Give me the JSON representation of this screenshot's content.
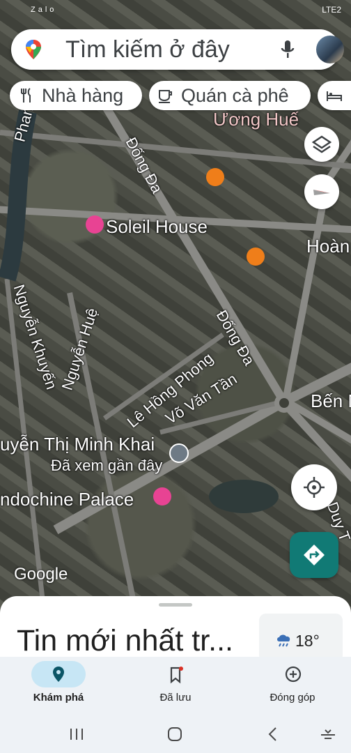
{
  "status_bar": {
    "time": "",
    "left_icons": "Zalo",
    "right_text": "LTE2"
  },
  "search": {
    "placeholder": "Tìm kiếm ở đây"
  },
  "chips": [
    {
      "label": "Nhà hàng",
      "icon": "restaurant-icon"
    },
    {
      "label": "Quán cà phê",
      "icon": "coffee-icon"
    },
    {
      "label": "",
      "icon": "hotel-icon"
    }
  ],
  "map": {
    "place_labels": {
      "soleil": "Soleil House",
      "minh_khai": "uyễn Thị Minh Khai",
      "recent": "Đã xem gần đây",
      "indochine": "ndochine Palace",
      "uong_hue": "Ương Huế",
      "hoan": "Hoàn",
      "ben": "Bến N"
    },
    "street_labels": {
      "dong_da_top": "Đống Đa",
      "dong_da_mid": "Đống Đa",
      "phan": "Phan",
      "nguyen_khuyen": "Nguyễn Khuyến",
      "nguyen_hue": "Nguyễn Huệ",
      "le_hong_phong": "Lê Hồng Phong",
      "vo_van_tan": "Võ Văn Tần",
      "duy": "Duy T"
    },
    "attribution": "Google",
    "colors": {
      "directions": "#117a75",
      "hotel_poi": "#e84393",
      "cafe_poi": "#ef7e1a"
    }
  },
  "sheet": {
    "title": "Tin mới nhất tr...",
    "weather_temp": "18°"
  },
  "bottom_nav": [
    {
      "label": "Khám phá",
      "active": true
    },
    {
      "label": "Đã lưu",
      "active": false
    },
    {
      "label": "Đóng góp",
      "active": false
    }
  ]
}
